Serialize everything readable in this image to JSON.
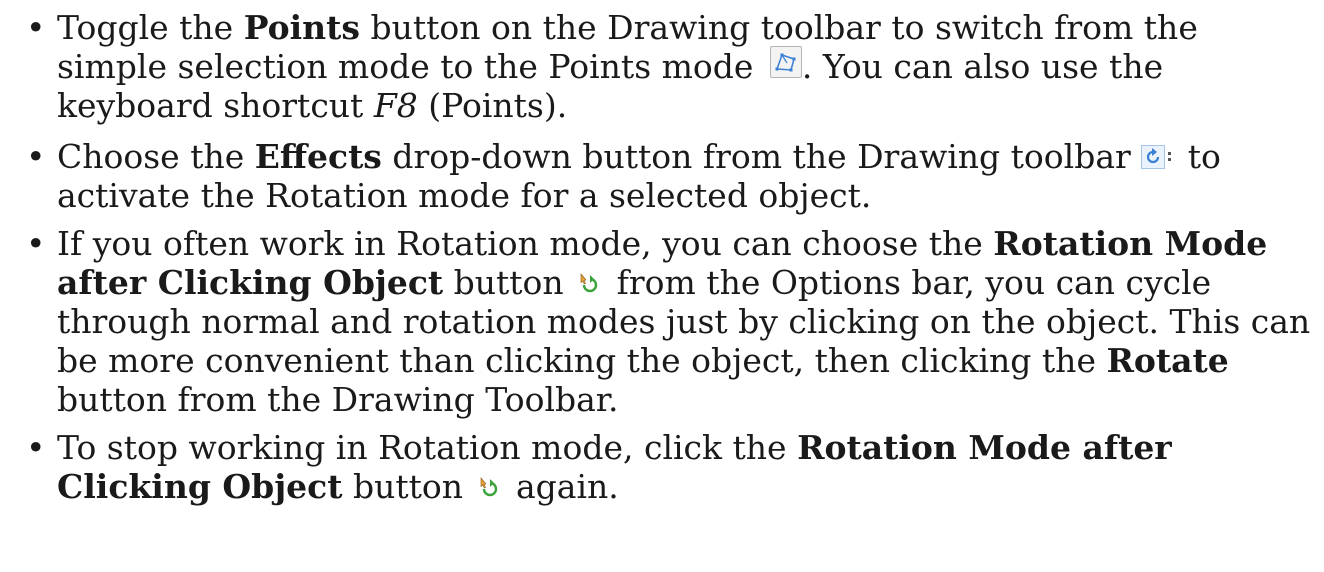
{
  "bullets": [
    {
      "t1": "Toggle the ",
      "b1": "Points",
      "t2": " button on the Drawing toolbar to switch from the simple selection mode to the Points mode ",
      "t3": ". You can also use the keyboard shortcut ",
      "i1": "F8",
      "t4": " (Points)."
    },
    {
      "t1": "Choose the ",
      "b1": "Effects",
      "t2": " drop-down button from the Drawing toolbar ",
      "t3": " to activate the Rotation mode for a selected object."
    },
    {
      "t1": "If you often work in Rotation mode, you can choose the ",
      "b1": "Rotation Mode after Clicking Object",
      "t2": " button ",
      "t3": " from the Options bar, you can cycle through normal and rotation modes just by clicking on the object. This can be more convenient than clicking the object, then clicking the ",
      "b2": "Rotate",
      "t4": " button from the Drawing Toolbar."
    },
    {
      "t1": "To stop working in Rotation mode, click the ",
      "b1": "Rotation Mode after Clicking Object",
      "t2": " button ",
      "t3": " again."
    }
  ],
  "bullet_symbol": "•",
  "icons": {
    "points": "points-mode-icon",
    "effects": "effects-rotate-icon",
    "rotation_mode": "rotation-mode-icon"
  },
  "colors": {
    "text": "#1a1a1a",
    "icon_blue": "#3a7fd4",
    "icon_green": "#3aa33a",
    "icon_orange": "#e8a33a"
  }
}
